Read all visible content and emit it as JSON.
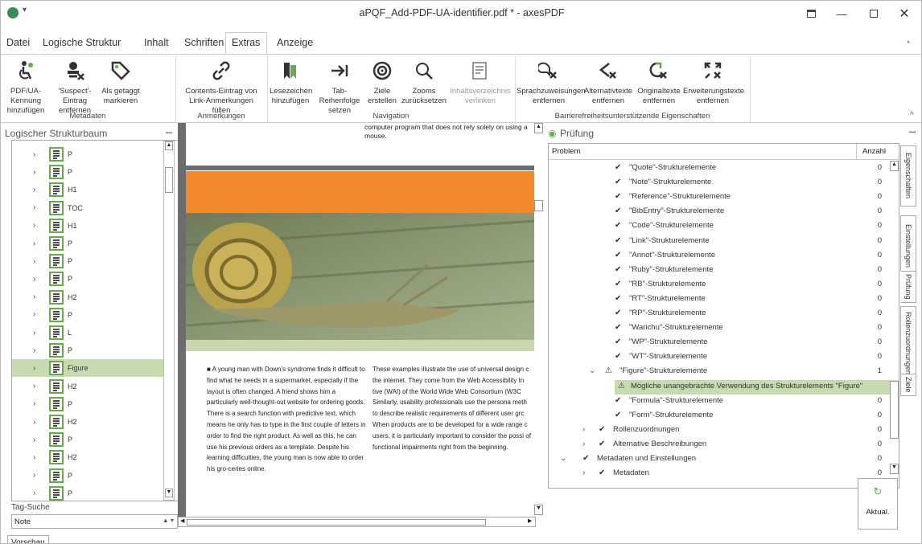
{
  "window": {
    "title": "aPQF_Add-PDF-UA-identifier.pdf * - axesPDF"
  },
  "menu": [
    "Datei",
    "Logische Struktur",
    "Inhalt",
    "Schriften",
    "Extras",
    "Anzeige"
  ],
  "ribbon": {
    "buttons": [
      {
        "label": "PDF/UA-Kennung hinzufügen",
        "icon": "accessibility-icon"
      },
      {
        "label": "'Suspect'-Eintrag entfernen",
        "icon": "suspect-remove-icon"
      },
      {
        "label": "Als getaggt markieren",
        "icon": "tag-icon"
      },
      {
        "label": "Contents-Eintrag von Link-Anmerkungen füllen",
        "icon": "link-icon"
      },
      {
        "label": "Lesezeichen hinzufügen",
        "icon": "bookmark-icon"
      },
      {
        "label": "Tab-Reihenfolge setzen",
        "icon": "tab-order-icon"
      },
      {
        "label": "Ziele erstellen",
        "icon": "target-icon"
      },
      {
        "label": "Zooms zurücksetzen",
        "icon": "zoom-icon"
      },
      {
        "label": "Inhaltsverzeichnis verlinken",
        "icon": "toc-link-icon"
      },
      {
        "label": "Sprachzuweisungen entfernen",
        "icon": "language-remove-icon"
      },
      {
        "label": "Alternativtexte entfernen",
        "icon": "alt-text-remove-icon"
      },
      {
        "label": "Originaltexte entfernen",
        "icon": "original-text-remove-icon"
      },
      {
        "label": "Erweiterungstexte entfernen",
        "icon": "expansion-text-remove-icon"
      }
    ],
    "groups": [
      "Metadaten",
      "Anmerkungen",
      "Navigation",
      "Barrierefreiheitsunterstützende Eigenschaften"
    ]
  },
  "left": {
    "title": "Logischer Strukturbaum",
    "tree": [
      {
        "label": "P",
        "icon": "paragraph-icon"
      },
      {
        "label": "P",
        "icon": "paragraph-icon"
      },
      {
        "label": "H1",
        "icon": "heading-icon"
      },
      {
        "label": "TOC",
        "icon": "toc-icon"
      },
      {
        "label": "H1",
        "icon": "heading-icon"
      },
      {
        "label": "P",
        "icon": "paragraph-icon"
      },
      {
        "label": "P",
        "icon": "paragraph-icon"
      },
      {
        "label": "P",
        "icon": "paragraph-icon"
      },
      {
        "label": "H2",
        "icon": "heading2-icon"
      },
      {
        "label": "P",
        "icon": "paragraph-icon"
      },
      {
        "label": "L",
        "icon": "list-icon"
      },
      {
        "label": "P",
        "icon": "paragraph-icon"
      },
      {
        "label": "Figure",
        "icon": "figure-icon"
      },
      {
        "label": "H2",
        "icon": "heading2-icon"
      },
      {
        "label": "P",
        "icon": "paragraph-icon"
      },
      {
        "label": "H2",
        "icon": "heading2-icon"
      },
      {
        "label": "P",
        "icon": "paragraph-icon"
      },
      {
        "label": "H2",
        "icon": "heading2-icon"
      },
      {
        "label": "P",
        "icon": "paragraph-icon"
      },
      {
        "label": "P",
        "icon": "paragraph-icon"
      }
    ],
    "selected_index": 12,
    "tag_search_label": "Tag-Suche",
    "tag_search_value": "Note",
    "bottom_tab": "Vorschau"
  },
  "doc": {
    "top_text": "computer program that does not rely solely on using a mouse.",
    "col1": "A young man with Down's syndrome finds it difficult to find what he needs in a supermarket, especially if the layout is often changed. A friend shows him a particularly well-thought-out website for ordering goods. There is a search function with predictive text, which means he only has to type in the first couple of letters in order to find the right product. As well as this, he can use his previous orders as a template. Despite his learning difficulties, the young man is now able to order his gro-ceries online.",
    "col2": "These examples illustrate the use of universal design c the internet. They come from the Web Accessibility In tive (WAI) of the World Wide Web Consortium (W3C Similarly, usability professionals use the persona meth to describe realistic requirements of different user grc When products are to be developed for a wide range c users, it is particularly important to consider the possi of functional impairments right from the beginning.",
    "banner_color": "#f08a2c"
  },
  "right": {
    "title": "Prüfung",
    "columns": [
      "Problem",
      "Anzahl"
    ],
    "rows": [
      {
        "text": "\"Quote\"-Strukturelemente",
        "count": "0",
        "indent": 2
      },
      {
        "text": "\"Note\"-Strukturelemente",
        "count": "0",
        "indent": 2
      },
      {
        "text": "\"Reference\"-Strukturelemente",
        "count": "0",
        "indent": 2
      },
      {
        "text": "\"BibEntry\"-Strukturelemente",
        "count": "0",
        "indent": 2
      },
      {
        "text": "\"Code\"-Strukturelemente",
        "count": "0",
        "indent": 2
      },
      {
        "text": "\"Link\"-Strukturelemente",
        "count": "0",
        "indent": 2
      },
      {
        "text": "\"Annot\"-Strukturelemente",
        "count": "0",
        "indent": 2
      },
      {
        "text": "\"Ruby\"-Strukturelemente",
        "count": "0",
        "indent": 2
      },
      {
        "text": "\"RB\"-Strukturelemente",
        "count": "0",
        "indent": 2
      },
      {
        "text": "\"RT\"-Strukturelemente",
        "count": "0",
        "indent": 2
      },
      {
        "text": "\"RP\"-Strukturelemente",
        "count": "0",
        "indent": 2
      },
      {
        "text": "\"Warichu\"-Strukturelemente",
        "count": "0",
        "indent": 2
      },
      {
        "text": "\"WP\"-Strukturelemente",
        "count": "0",
        "indent": 2
      },
      {
        "text": "\"WT\"-Strukturelemente",
        "count": "0",
        "indent": 2
      },
      {
        "text": "\"Figure\"-Strukturelemente",
        "count": "1",
        "indent": 2,
        "warn": true,
        "expanded": true
      },
      {
        "text": "Mögliche unangebrachte Verwendung des Strukturelements \"Figure\"",
        "count": "",
        "indent": 3,
        "warn": true,
        "selected": true
      },
      {
        "text": "\"Formula\"-Strukturelemente",
        "count": "0",
        "indent": 2
      },
      {
        "text": "\"Form\"-Strukturelemente",
        "count": "0",
        "indent": 2
      },
      {
        "text": "Rollenzuordnungen",
        "count": "0",
        "indent": 1,
        "collapsed": true
      },
      {
        "text": "Alternative Beschreibungen",
        "count": "0",
        "indent": 1,
        "collapsed": true
      },
      {
        "text": "Metadaten und Einstellungen",
        "count": "0",
        "indent": 0,
        "expanded": true
      },
      {
        "text": "Metadaten",
        "count": "0",
        "indent": 1,
        "collapsed": true
      }
    ],
    "update_button": "Aktual.",
    "side_tabs": [
      "Eigenschaften",
      "Einstellungen",
      "Prüfung",
      "Rollenzuordnungen",
      "Ziele"
    ]
  }
}
